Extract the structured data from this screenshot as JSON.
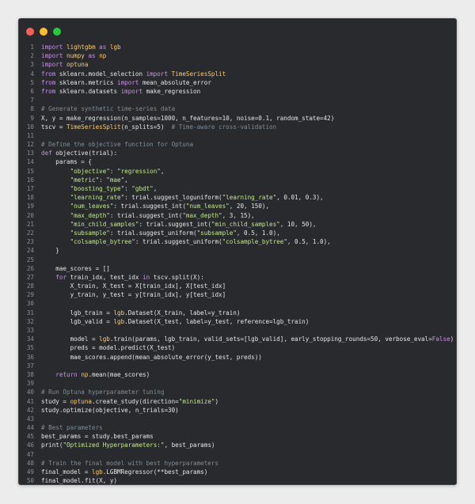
{
  "window": {
    "buttons": [
      "close",
      "minimize",
      "zoom"
    ],
    "colors": {
      "background": "#282a2e",
      "close": "#ff5f56",
      "minimize": "#ffbd2e",
      "zoom": "#27c93f",
      "keyword": "#c792ea",
      "module": "#ffcb6b",
      "string": "#c3e88d",
      "number": "#f78c6c",
      "comment": "#7f8c98"
    }
  },
  "code_lines": [
    [
      [
        "kw",
        "import"
      ],
      [
        "id",
        " "
      ],
      [
        "mod",
        "lightgbm"
      ],
      [
        "id",
        " "
      ],
      [
        "kw",
        "as"
      ],
      [
        "id",
        " "
      ],
      [
        "mod",
        "lgb"
      ]
    ],
    [
      [
        "kw",
        "import"
      ],
      [
        "id",
        " "
      ],
      [
        "mod",
        "numpy"
      ],
      [
        "id",
        " "
      ],
      [
        "kw",
        "as"
      ],
      [
        "id",
        " "
      ],
      [
        "mod",
        "np"
      ]
    ],
    [
      [
        "kw",
        "import"
      ],
      [
        "id",
        " "
      ],
      [
        "mod",
        "optuna"
      ]
    ],
    [
      [
        "kw",
        "from"
      ],
      [
        "id",
        " sklearn.model_selection "
      ],
      [
        "kw",
        "import"
      ],
      [
        "id",
        " "
      ],
      [
        "mod",
        "TimeSeriesSplit"
      ]
    ],
    [
      [
        "kw",
        "from"
      ],
      [
        "id",
        " sklearn.metrics "
      ],
      [
        "kw",
        "import"
      ],
      [
        "id",
        " mean_absolute_error"
      ]
    ],
    [
      [
        "kw",
        "from"
      ],
      [
        "id",
        " sklearn.datasets "
      ],
      [
        "kw",
        "import"
      ],
      [
        "id",
        " make_regression"
      ]
    ],
    [],
    [
      [
        "com",
        "# Generate synthetic time-series data"
      ]
    ],
    [
      [
        "id",
        "X, y = make_regression(n_samples=1000, n_features=10, noise=0.1, random_state=42)"
      ]
    ],
    [
      [
        "id",
        "tscv = "
      ],
      [
        "mod",
        "TimeSeriesSplit"
      ],
      [
        "id",
        "(n_splits=5)  "
      ],
      [
        "com",
        "# Time-aware cross-validation"
      ]
    ],
    [],
    [
      [
        "com",
        "# Define the objective function for Optuna"
      ]
    ],
    [
      [
        "kw",
        "def"
      ],
      [
        "id",
        " objective(trial):"
      ]
    ],
    [
      [
        "id",
        "    params = {"
      ]
    ],
    [
      [
        "id",
        "        "
      ],
      [
        "str",
        "\"objective\": \"regression\""
      ],
      [
        "id",
        ","
      ]
    ],
    [
      [
        "id",
        "        "
      ],
      [
        "str",
        "\"metric\": \"mae\""
      ],
      [
        "id",
        ","
      ]
    ],
    [
      [
        "id",
        "        "
      ],
      [
        "str",
        "\"boosting_type\": \"gbdt\""
      ],
      [
        "id",
        ","
      ]
    ],
    [
      [
        "id",
        "        "
      ],
      [
        "str",
        "\"learning_rate\""
      ],
      [
        "id",
        ": trial.suggest_loguniform("
      ],
      [
        "str",
        "\"learning_rate\""
      ],
      [
        "id",
        ", 0.01, 0.3),"
      ]
    ],
    [
      [
        "id",
        "        "
      ],
      [
        "str",
        "\"num_leaves\""
      ],
      [
        "id",
        ": trial.suggest_int("
      ],
      [
        "str",
        "\"num_leaves\""
      ],
      [
        "id",
        ", 20, 150),"
      ]
    ],
    [
      [
        "id",
        "        "
      ],
      [
        "str",
        "\"max_depth\""
      ],
      [
        "id",
        ": trial.suggest_int("
      ],
      [
        "str",
        "\"max_depth\""
      ],
      [
        "id",
        ", 3, 15),"
      ]
    ],
    [
      [
        "id",
        "        "
      ],
      [
        "str",
        "\"min_child_samples\""
      ],
      [
        "id",
        ": trial.suggest_int("
      ],
      [
        "str",
        "\"min_child_samples\""
      ],
      [
        "id",
        ", 10, 50),"
      ]
    ],
    [
      [
        "id",
        "        "
      ],
      [
        "str",
        "\"subsample\""
      ],
      [
        "id",
        ": trial.suggest_uniform("
      ],
      [
        "str",
        "\"subsample\""
      ],
      [
        "id",
        ", 0.5, 1.0),"
      ]
    ],
    [
      [
        "id",
        "        "
      ],
      [
        "str",
        "\"colsample_bytree\""
      ],
      [
        "id",
        ": trial.suggest_uniform("
      ],
      [
        "str",
        "\"colsample_bytree\""
      ],
      [
        "id",
        ", 0.5, 1.0),"
      ]
    ],
    [
      [
        "id",
        "    }"
      ]
    ],
    [],
    [
      [
        "id",
        "    mae_scores = []"
      ]
    ],
    [
      [
        "id",
        "    "
      ],
      [
        "kw",
        "for"
      ],
      [
        "id",
        " train_idx, test_idx "
      ],
      [
        "kw",
        "in"
      ],
      [
        "id",
        " tscv.split(X):"
      ]
    ],
    [
      [
        "id",
        "        X_train, X_test = X[train_idx], X[test_idx]"
      ]
    ],
    [
      [
        "id",
        "        y_train, y_test = y[train_idx], y[test_idx]"
      ]
    ],
    [],
    [
      [
        "id",
        "        lgb_train = "
      ],
      [
        "mod",
        "lgb"
      ],
      [
        "id",
        ".Dataset(X_train, label=y_train)"
      ]
    ],
    [
      [
        "id",
        "        lgb_valid = "
      ],
      [
        "mod",
        "lgb"
      ],
      [
        "id",
        ".Dataset(X_test, label=y_test, reference=lgb_train)"
      ]
    ],
    [],
    [
      [
        "id",
        "        model = "
      ],
      [
        "mod",
        "lgb"
      ],
      [
        "id",
        ".train(params, lgb_train, valid_sets=[lgb_valid], early_stopping_rounds=50, verbose_eval="
      ],
      [
        "kw",
        "False"
      ],
      [
        "id",
        ")"
      ]
    ],
    [
      [
        "id",
        "        preds = model.predict(X_test)"
      ]
    ],
    [
      [
        "id",
        "        mae_scores.append(mean_absolute_error(y_test, preds))"
      ]
    ],
    [],
    [
      [
        "id",
        "    "
      ],
      [
        "kw",
        "return"
      ],
      [
        "id",
        " "
      ],
      [
        "mod",
        "np"
      ],
      [
        "id",
        ".mean(mae_scores)"
      ]
    ],
    [],
    [
      [
        "com",
        "# Run Optuna hyperparameter tuning"
      ]
    ],
    [
      [
        "id",
        "study = "
      ],
      [
        "mod",
        "optuna"
      ],
      [
        "id",
        ".create_study(direction="
      ],
      [
        "str",
        "\"minimize\""
      ],
      [
        "id",
        ")"
      ]
    ],
    [
      [
        "id",
        "study.optimize(objective, n_trials=30)"
      ]
    ],
    [],
    [
      [
        "com",
        "# Best parameters"
      ]
    ],
    [
      [
        "id",
        "best_params = study.best_params"
      ]
    ],
    [
      [
        "id",
        "print("
      ],
      [
        "str",
        "\"Optimized Hyperparameters:\""
      ],
      [
        "id",
        ", best_params)"
      ]
    ],
    [],
    [
      [
        "com",
        "# Train the final model with best hyperparameters"
      ]
    ],
    [
      [
        "id",
        "final_model = "
      ],
      [
        "mod",
        "lgb"
      ],
      [
        "id",
        ".LGBMRegressor(**best_params)"
      ]
    ],
    [
      [
        "id",
        "final_model.fit(X, y)"
      ]
    ]
  ]
}
